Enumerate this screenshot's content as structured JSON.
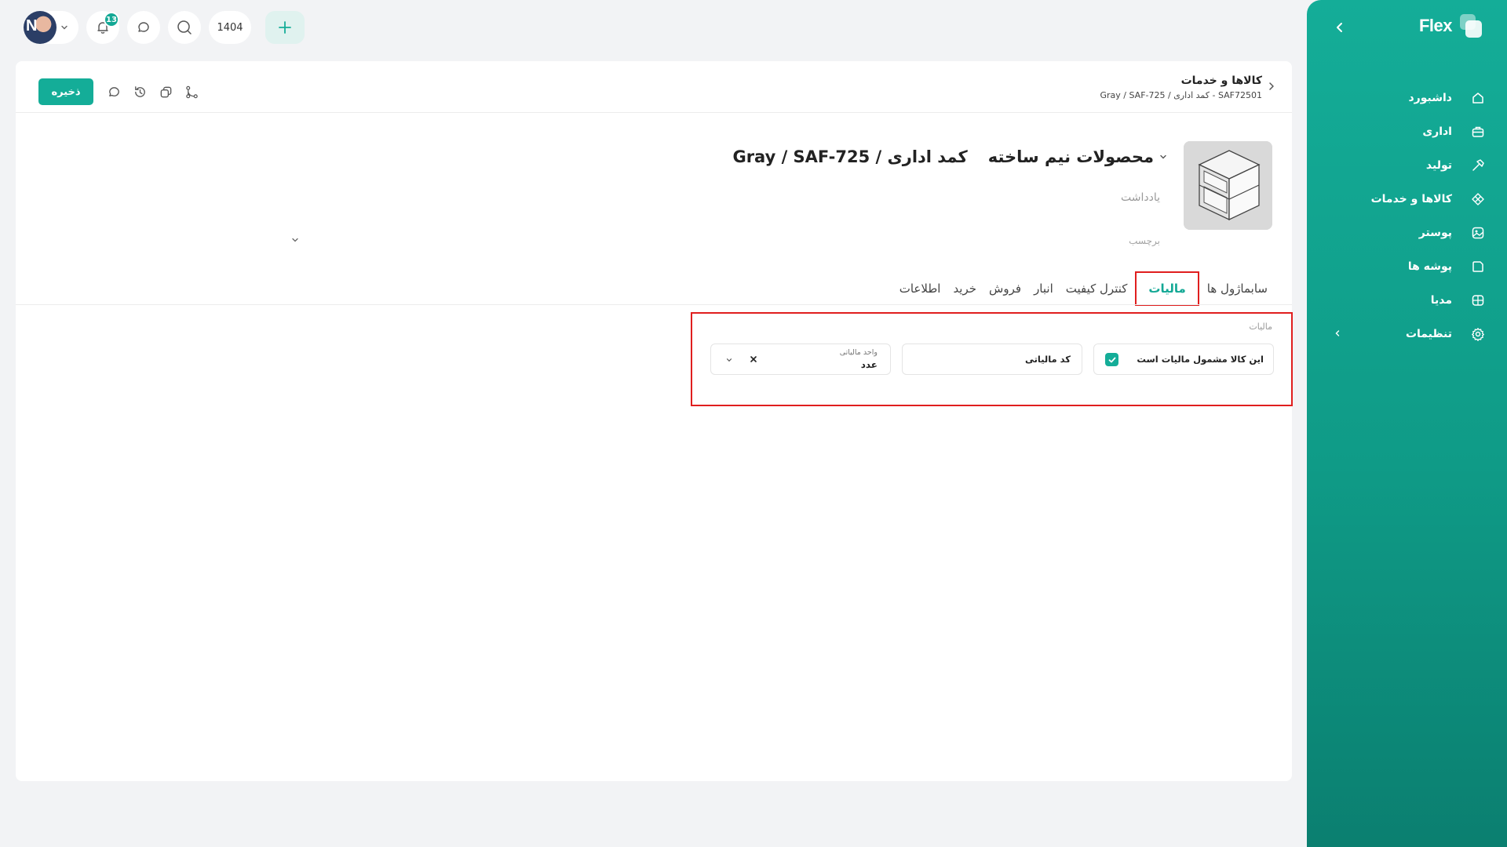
{
  "sidebar": {
    "brand": "Flex",
    "items": [
      {
        "label": "داشبورد",
        "icon": "home-icon"
      },
      {
        "label": "اداری",
        "icon": "briefcase-icon"
      },
      {
        "label": "تولید",
        "icon": "hammer-icon"
      },
      {
        "label": "کالاها و خدمات",
        "icon": "box-icon"
      },
      {
        "label": "پوستر",
        "icon": "image-icon"
      },
      {
        "label": "پوشه ها",
        "icon": "folder-icon"
      },
      {
        "label": "مدیا",
        "icon": "media-icon"
      },
      {
        "label": "تنظیمات",
        "icon": "gear-icon"
      }
    ]
  },
  "topbar": {
    "avatar_initial": "N",
    "notification_count": "13",
    "year": "1404"
  },
  "header": {
    "save_label": "ذخیره",
    "breadcrumb_title": "کالاها و خدمات",
    "breadcrumb_sub": "SAF72501 - کمد اداری / Gray / SAF-725"
  },
  "product": {
    "category": "محصولات نیم ساخته",
    "name": "کمد اداری / Gray / SAF-725",
    "note_placeholder": "یادداشت",
    "tag_placeholder": "برچسب"
  },
  "tabs": [
    {
      "label": "اطلاعات",
      "active": false
    },
    {
      "label": "خرید",
      "active": false
    },
    {
      "label": "فروش",
      "active": false
    },
    {
      "label": "انبار",
      "active": false
    },
    {
      "label": "کنترل کیفیت",
      "active": false
    },
    {
      "label": "مالیات",
      "active": true
    },
    {
      "label": "سابماژول ها",
      "active": false
    }
  ],
  "tax": {
    "section_label": "مالیات",
    "taxable_label": "این کالا مشمول مالیات است",
    "taxable_checked": true,
    "tax_code_placeholder": "کد مالیاتی",
    "tax_unit_label": "واحد مالیاتی",
    "tax_unit_value": "عدد"
  },
  "colors": {
    "accent": "#14ad98",
    "highlight": "#e01e1e"
  }
}
